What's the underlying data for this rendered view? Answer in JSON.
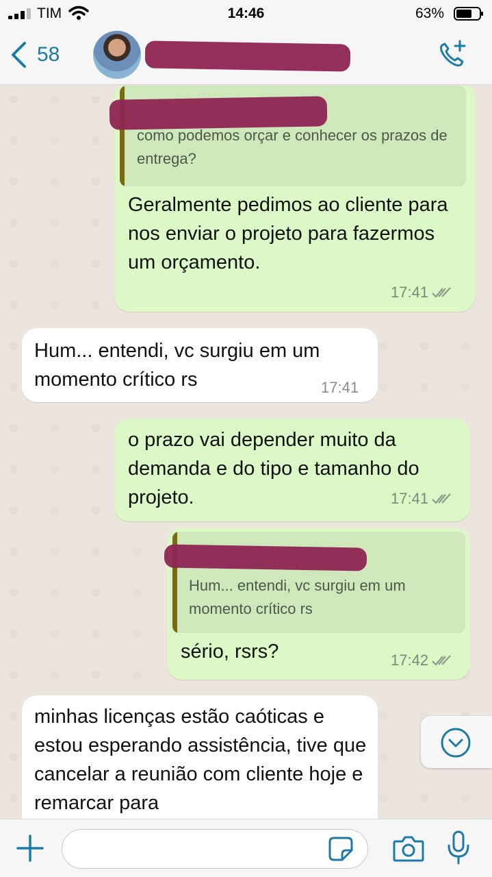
{
  "status_bar": {
    "carrier": "TIM",
    "time": "14:46",
    "battery": "63%"
  },
  "header": {
    "back_count": "58"
  },
  "messages": [
    {
      "direction": "out",
      "quote": "como podemos orçar e conhecer os prazos de entrega?",
      "text": "Geralmente pedimos ao cliente para nos enviar o projeto para fazermos um orçamento.",
      "time": "17:41"
    },
    {
      "direction": "in",
      "text": "Hum... entendi, vc surgiu em um momento crítico rs",
      "time": "17:41"
    },
    {
      "direction": "out",
      "text": "o prazo vai depender muito da demanda e do tipo e tamanho do projeto.",
      "time": "17:41"
    },
    {
      "direction": "out",
      "quote": "Hum... entendi, vc surgiu em um momento crítico rs",
      "text": "sério, rsrs?",
      "time": "17:42"
    },
    {
      "direction": "in",
      "text": "minhas licenças estão caóticas e estou esperando assistência, tive que cancelar a reunião com cliente hoje e remarcar para"
    }
  ],
  "icons": {
    "back": "chevron-left-icon",
    "call": "add-call-icon",
    "scroll": "chevron-down-icon",
    "attach": "plus-icon",
    "sticker": "sticker-icon",
    "camera": "camera-icon",
    "mic": "microphone-icon"
  },
  "colors": {
    "accent": "#1c7aa9",
    "outgoing": "#dcf8c6",
    "incoming": "#ffffff",
    "redaction": "#8e2552"
  }
}
